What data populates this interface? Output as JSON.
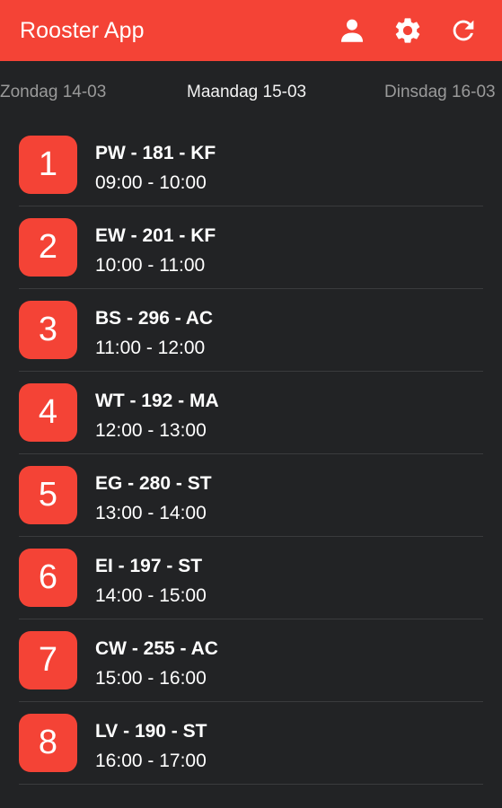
{
  "app": {
    "title": "Rooster App"
  },
  "toolbar": {
    "icons": [
      "person-icon",
      "settings-icon",
      "refresh-icon"
    ]
  },
  "tabs": {
    "prev": "Zondag 14-03",
    "current": "Maandag 15-03",
    "next": "Dinsdag 16-03"
  },
  "lessons": [
    {
      "hour": "1",
      "code": "PW - 181 - KF",
      "time": "09:00 - 10:00"
    },
    {
      "hour": "2",
      "code": "EW - 201 - KF",
      "time": "10:00 - 11:00"
    },
    {
      "hour": "3",
      "code": "BS - 296 - AC",
      "time": "11:00 - 12:00"
    },
    {
      "hour": "4",
      "code": "WT - 192 - MA",
      "time": "12:00 - 13:00"
    },
    {
      "hour": "5",
      "code": "EG - 280 - ST",
      "time": "13:00 - 14:00"
    },
    {
      "hour": "6",
      "code": "EI - 197 - ST",
      "time": "14:00 - 15:00"
    },
    {
      "hour": "7",
      "code": "CW - 255 - AC",
      "time": "15:00 - 16:00"
    },
    {
      "hour": "8",
      "code": "LV - 190 - ST",
      "time": "16:00 - 17:00"
    }
  ],
  "colors": {
    "accent": "#f44336",
    "background": "#222325",
    "text": "#ffffff"
  }
}
